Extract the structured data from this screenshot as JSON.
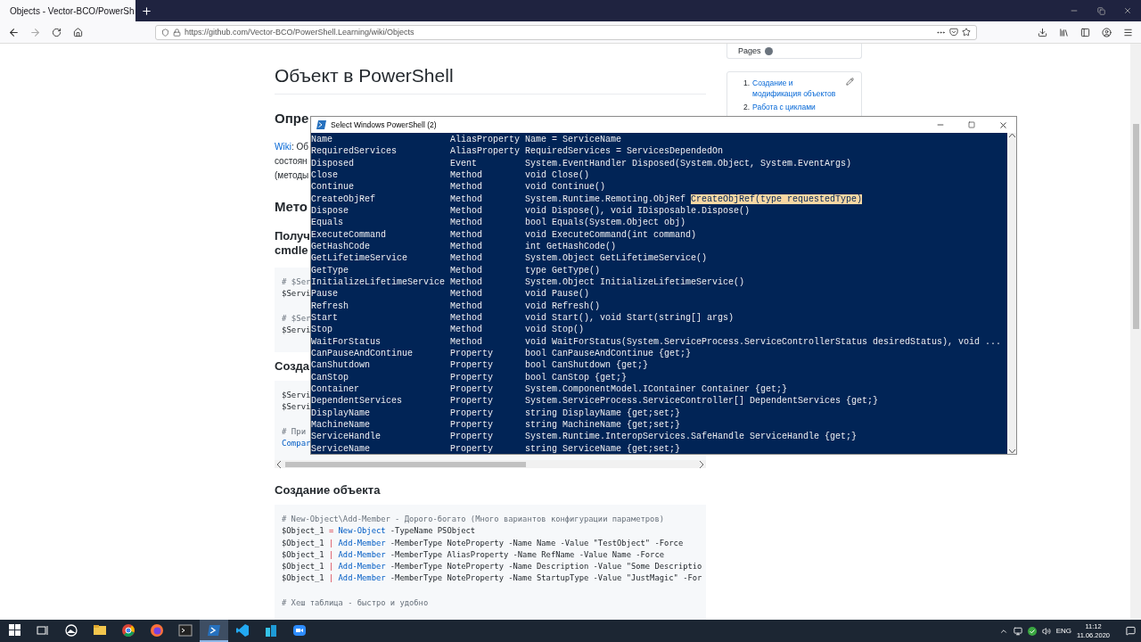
{
  "browser": {
    "tab": {
      "title": "Objects - Vector-BCO/PowerSh",
      "selected": true
    },
    "url": "https://github.com/Vector-BCO/PowerShell.Learning/wiki/Objects"
  },
  "article": {
    "title": "Объект в PowerShell",
    "blocks": [
      {
        "kind": "h2",
        "text": "Опре"
      },
      {
        "kind": "paragraph",
        "lines": [
          [
            {
              "kind": "link",
              "text": "Wiki"
            },
            {
              "kind": "plain",
              "text": ": Об"
            }
          ],
          [
            {
              "kind": "plain",
              "text": "состоян"
            }
          ],
          [
            {
              "kind": "plain",
              "text": "(методы"
            }
          ]
        ]
      },
      {
        "kind": "h2",
        "text": "Мето"
      },
      {
        "kind": "h3",
        "lines": [
          "Получ",
          "cmdle"
        ]
      },
      {
        "kind": "code",
        "groups": [
          [
            [
              {
                "kind": "comment",
                "text": "# $Ser"
              }
            ],
            [
              {
                "kind": "plain",
                "text": "$Servi"
              }
            ]
          ],
          [
            [
              {
                "kind": "comment",
                "text": "# $Ser"
              }
            ],
            [
              {
                "kind": "plain",
                "text": "$Servi"
              }
            ]
          ]
        ]
      },
      {
        "kind": "h3",
        "lines": [
          "Созда"
        ]
      },
      {
        "kind": "scrolling-code",
        "groups": [
          [
            [
              {
                "kind": "plain",
                "text": "$Servi"
              }
            ],
            [
              {
                "kind": "plain",
                "text": "$Servi"
              }
            ]
          ],
          [
            [
              {
                "kind": "comment",
                "text": "# При"
              }
            ],
            [
              {
                "kind": "cmdlet",
                "text": "Compar"
              }
            ]
          ]
        ]
      },
      {
        "kind": "h3",
        "lines": [
          "Создание объекта"
        ]
      },
      {
        "kind": "code",
        "groups": [
          [
            [
              {
                "kind": "comment",
                "text": "# New-Object\\Add-Member - Дорого-богато (Много вариантов конфигурации параметров)"
              }
            ],
            [
              {
                "kind": "plain",
                "text": "$Object_1 "
              },
              {
                "kind": "operator",
                "text": "= "
              },
              {
                "kind": "cmdlet",
                "text": "New-Object"
              },
              {
                "kind": "plain",
                "text": " -TypeName PSObject"
              }
            ],
            [
              {
                "kind": "plain",
                "text": "$Object_1 "
              },
              {
                "kind": "operator",
                "text": "| "
              },
              {
                "kind": "cmdlet",
                "text": "Add-Member"
              },
              {
                "kind": "plain",
                "text": " -MemberType NoteProperty -Name Name -Value \"TestObject\" -Force"
              }
            ],
            [
              {
                "kind": "plain",
                "text": "$Object_1 "
              },
              {
                "kind": "operator",
                "text": "| "
              },
              {
                "kind": "cmdlet",
                "text": "Add-Member"
              },
              {
                "kind": "plain",
                "text": " -MemberType AliasProperty -Name RefName -Value Name -Force"
              }
            ],
            [
              {
                "kind": "plain",
                "text": "$Object_1 "
              },
              {
                "kind": "operator",
                "text": "| "
              },
              {
                "kind": "cmdlet",
                "text": "Add-Member"
              },
              {
                "kind": "plain",
                "text": " -MemberType NoteProperty -Name Description -Value \"Some Descriptio"
              }
            ],
            [
              {
                "kind": "plain",
                "text": "$Object_1 "
              },
              {
                "kind": "operator",
                "text": "| "
              },
              {
                "kind": "cmdlet",
                "text": "Add-Member"
              },
              {
                "kind": "plain",
                "text": " -MemberType NoteProperty -Name StartupType -Value \"JustMagic\" -For"
              }
            ]
          ],
          [
            [
              {
                "kind": "comment",
                "text": "# Хеш таблица - быстро и удобно"
              }
            ]
          ]
        ]
      }
    ]
  },
  "sidebar": {
    "pages_label": "Pages",
    "toc": [
      {
        "number": "1.",
        "text": "Создание и модификация объектов"
      },
      {
        "number": "2.",
        "text": "Работа с циклами"
      }
    ]
  },
  "console": {
    "title": "Select Windows PowerShell (2)",
    "rows": [
      {
        "name": "Name",
        "member_type": "AliasProperty",
        "definition": "Name = ServiceName"
      },
      {
        "name": "RequiredServices",
        "member_type": "AliasProperty",
        "definition": "RequiredServices = ServicesDependedOn"
      },
      {
        "name": "Disposed",
        "member_type": "Event",
        "definition": "System.EventHandler Disposed(System.Object, System.EventArgs)"
      },
      {
        "name": "Close",
        "member_type": "Method",
        "definition": "void Close()"
      },
      {
        "name": "Continue",
        "member_type": "Method",
        "definition": "void Continue()"
      },
      {
        "name": "CreateObjRef",
        "member_type": "Method",
        "definition": "System.Runtime.Remoting.ObjRef ",
        "highlight": "CreateObjRef(type requestedType)"
      },
      {
        "name": "Dispose",
        "member_type": "Method",
        "definition": "void Dispose(), void IDisposable.Dispose()"
      },
      {
        "name": "Equals",
        "member_type": "Method",
        "definition": "bool Equals(System.Object obj)"
      },
      {
        "name": "ExecuteCommand",
        "member_type": "Method",
        "definition": "void ExecuteCommand(int command)"
      },
      {
        "name": "GetHashCode",
        "member_type": "Method",
        "definition": "int GetHashCode()"
      },
      {
        "name": "GetLifetimeService",
        "member_type": "Method",
        "definition": "System.Object GetLifetimeService()"
      },
      {
        "name": "GetType",
        "member_type": "Method",
        "definition": "type GetType()"
      },
      {
        "name": "InitializeLifetimeService",
        "member_type": "Method",
        "definition": "System.Object InitializeLifetimeService()"
      },
      {
        "name": "Pause",
        "member_type": "Method",
        "definition": "void Pause()"
      },
      {
        "name": "Refresh",
        "member_type": "Method",
        "definition": "void Refresh()"
      },
      {
        "name": "Start",
        "member_type": "Method",
        "definition": "void Start(), void Start(string[] args)"
      },
      {
        "name": "Stop",
        "member_type": "Method",
        "definition": "void Stop()"
      },
      {
        "name": "WaitForStatus",
        "member_type": "Method",
        "definition": "void WaitForStatus(System.ServiceProcess.ServiceControllerStatus desiredStatus), void ..."
      },
      {
        "name": "CanPauseAndContinue",
        "member_type": "Property",
        "definition": "bool CanPauseAndContinue {get;}"
      },
      {
        "name": "CanShutdown",
        "member_type": "Property",
        "definition": "bool CanShutdown {get;}"
      },
      {
        "name": "CanStop",
        "member_type": "Property",
        "definition": "bool CanStop {get;}"
      },
      {
        "name": "Container",
        "member_type": "Property",
        "definition": "System.ComponentModel.IContainer Container {get;}"
      },
      {
        "name": "DependentServices",
        "member_type": "Property",
        "definition": "System.ServiceProcess.ServiceController[] DependentServices {get;}"
      },
      {
        "name": "DisplayName",
        "member_type": "Property",
        "definition": "string DisplayName {get;set;}"
      },
      {
        "name": "MachineName",
        "member_type": "Property",
        "definition": "string MachineName {get;set;}"
      },
      {
        "name": "ServiceHandle",
        "member_type": "Property",
        "definition": "System.Runtime.InteropServices.SafeHandle ServiceHandle {get;}"
      },
      {
        "name": "ServiceName",
        "member_type": "Property",
        "definition": "string ServiceName {get;set;}"
      }
    ]
  },
  "taskbar": {
    "apps": [
      {
        "kind": "photos",
        "selected": false
      },
      {
        "kind": "folder",
        "selected": false
      },
      {
        "kind": "chrome",
        "selected": false
      },
      {
        "kind": "firefox",
        "selected": false
      },
      {
        "kind": "terminal",
        "selected": false
      },
      {
        "kind": "powershell",
        "selected": true
      },
      {
        "kind": "vscode",
        "selected": false
      },
      {
        "kind": "buildings",
        "selected": false
      },
      {
        "kind": "camera",
        "selected": false
      }
    ],
    "language": "ENG",
    "time": "11:12",
    "date": "11.06.2020"
  }
}
